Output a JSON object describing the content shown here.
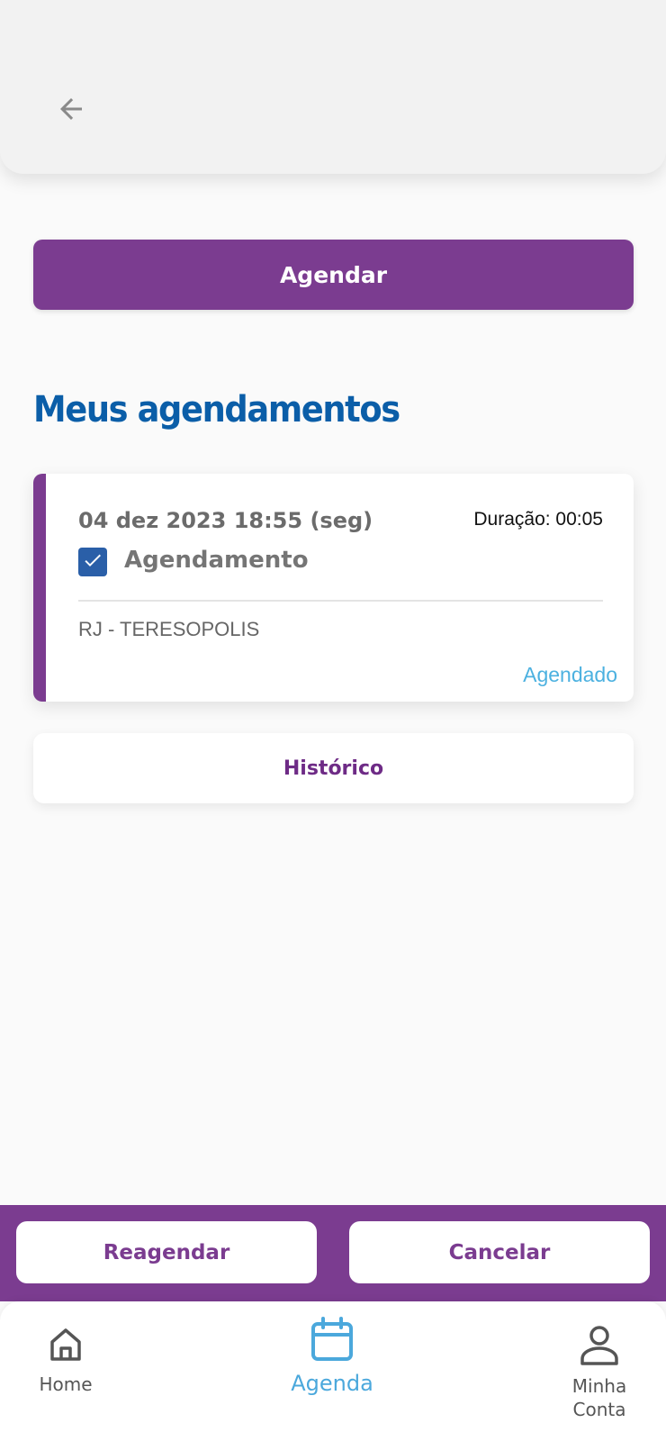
{
  "header": {
    "back_icon": "arrow-left-icon"
  },
  "actions": {
    "schedule_label": "Agendar"
  },
  "section": {
    "title": "Meus agendamentos"
  },
  "appointment": {
    "date": "04 dez 2023 18:55 (seg)",
    "duration": "Duração: 00:05",
    "checked": true,
    "type": "Agendamento",
    "location": "RJ - TERESOPOLIS",
    "status": "Agendado"
  },
  "history": {
    "label": "Histórico"
  },
  "action_bar": {
    "reschedule_label": "Reagendar",
    "cancel_label": "Cancelar"
  },
  "nav": {
    "items": [
      {
        "label": "Home",
        "icon": "home-icon",
        "active": false
      },
      {
        "label": "Agenda",
        "icon": "calendar-icon",
        "active": true
      },
      {
        "label": "Minha Conta",
        "icon": "user-icon",
        "active": false
      }
    ]
  },
  "colors": {
    "brand_purple": "#7b3c90",
    "title_blue": "#0b5ea8",
    "status_blue": "#4cb1e0",
    "checkbox_blue": "#2a5fa8"
  }
}
